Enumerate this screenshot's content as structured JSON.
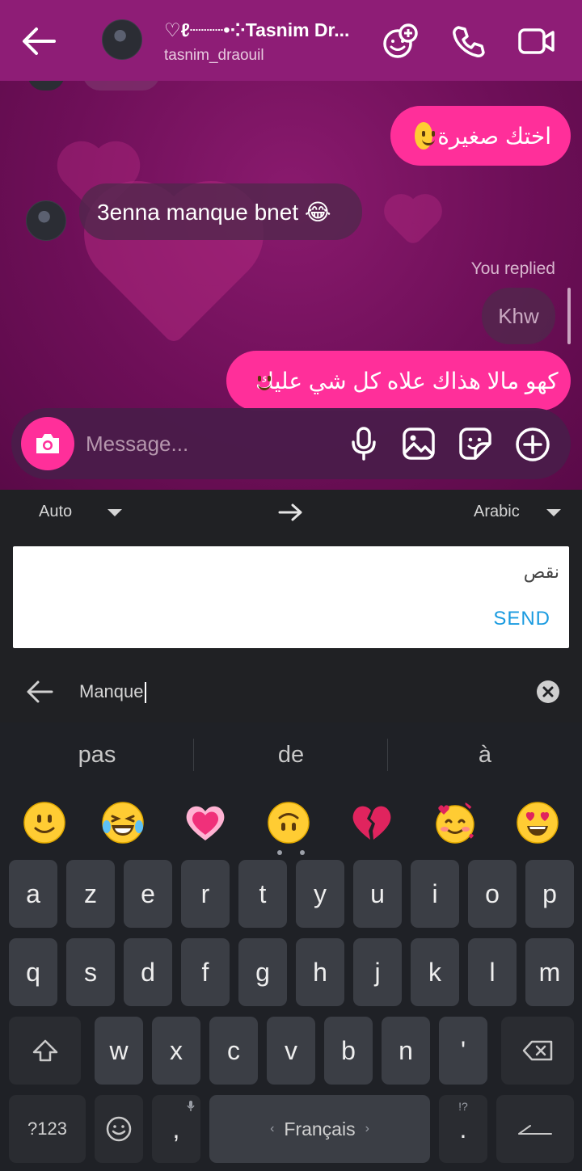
{
  "header": {
    "contact_name": "♡ℓ┈┈┈•⁘Tasnim Dr...",
    "username": "tasnim_draouil"
  },
  "messages": [
    {
      "from": "me",
      "text": "اختك صغيرة",
      "emoji": "slightly-smiling-face"
    },
    {
      "from": "them",
      "text": "3enna manque bnet 😂"
    },
    {
      "label": "You replied"
    },
    {
      "quoted": "Khw"
    },
    {
      "from": "me",
      "text": "كهو مالا هذاك علاه كل شي عليك",
      "emoji": "slightly-smiling-face"
    }
  ],
  "composer": {
    "placeholder": "Message..."
  },
  "translate": {
    "source_language": "Auto",
    "target_language": "Arabic",
    "output_text": "نقص",
    "send_label": "SEND",
    "input_text": "Manque"
  },
  "keyboard": {
    "suggestions": [
      "pas",
      "de",
      "à"
    ],
    "emoji_row": [
      "🙂",
      "😂",
      "💗",
      "🙃",
      "💔",
      "🥰",
      "😍"
    ],
    "row1": [
      "a",
      "z",
      "e",
      "r",
      "t",
      "y",
      "u",
      "i",
      "o",
      "p"
    ],
    "row2": [
      "q",
      "s",
      "d",
      "f",
      "g",
      "h",
      "j",
      "k",
      "l",
      "m"
    ],
    "row3": [
      "w",
      "x",
      "c",
      "v",
      "b",
      "n",
      "'"
    ],
    "symbols_label": "?123",
    "comma_label": ",",
    "space_label": "Français",
    "period_label": ".",
    "period_hint": "!?"
  },
  "colors": {
    "accent_pink": "#ff2f9a",
    "header_bg": "#8e1d76",
    "link_blue": "#1a9be0"
  }
}
